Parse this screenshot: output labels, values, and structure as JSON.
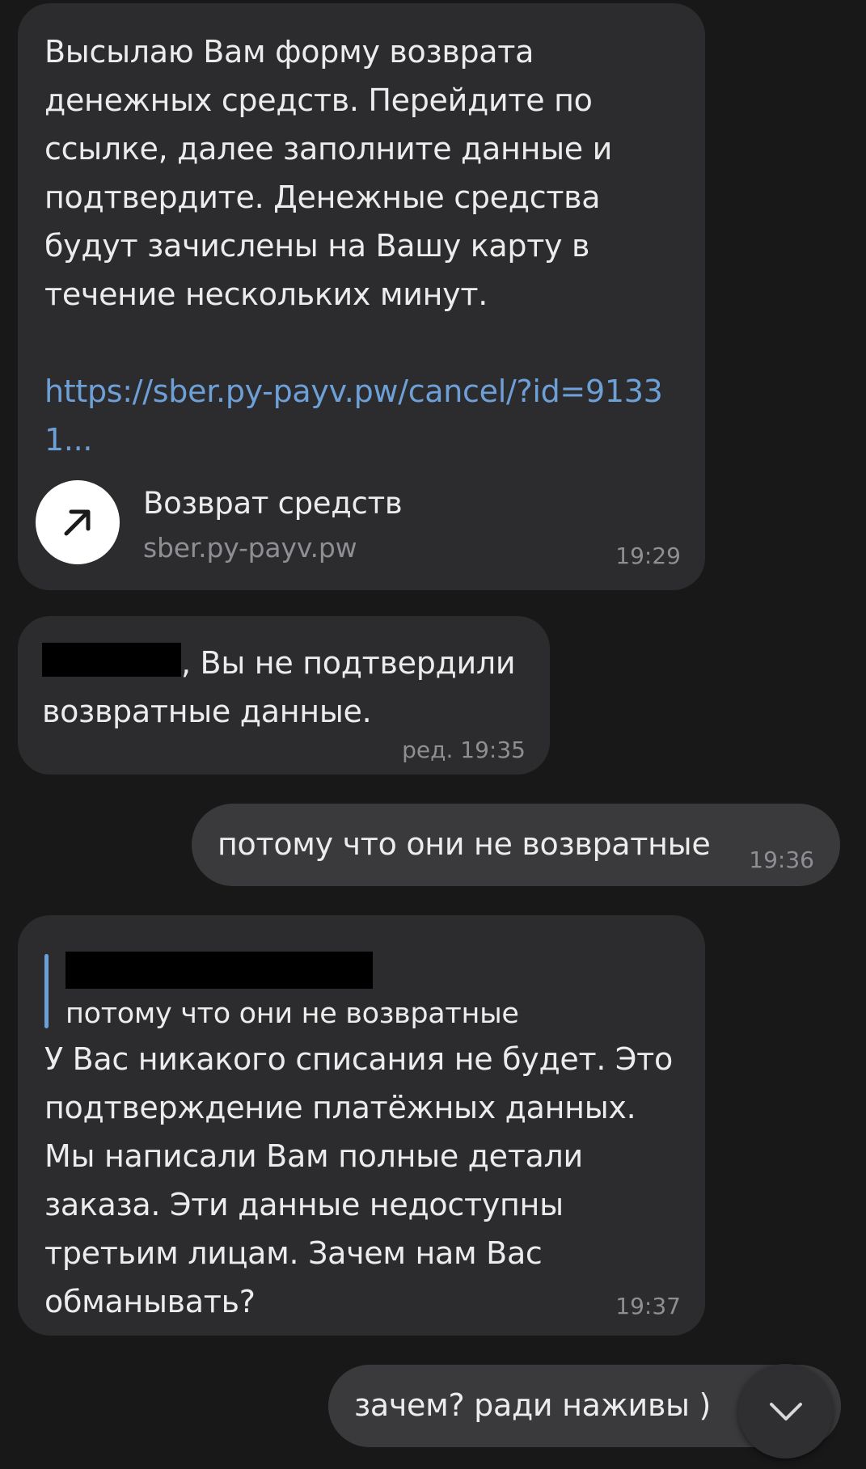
{
  "messages": {
    "m1": {
      "text": "Высылаю Вам форму возврата денежных средств. Перейдите по ссылке, далее заполните данные и подтвердите. Денежные средства будут зачислены на Вашу карту в течение нескольких минут.",
      "link": "https://sber.py-payv.pw/cancel/?id=91331...",
      "preview": {
        "icon": "arrow-up-right-icon",
        "title": "Возврат средств",
        "domain": "sber.py-payv.pw"
      },
      "time": "19:29"
    },
    "m2": {
      "text": ", Вы не подтвердили возвратные данные.",
      "time": "ред. 19:35"
    },
    "m3": {
      "text": "потому что они не возвратные",
      "time": "19:36"
    },
    "m4": {
      "reply_text": "потому что они не возвратные",
      "text": "У Вас никакого списания не будет. Это подтверждение платёжных данных. Мы написали Вам полные детали заказа. Эти данные недоступны третьим лицам. Зачем нам Вас обманывать?",
      "time": "19:37"
    },
    "m5": {
      "text": "зачем? ради наживы )"
    }
  },
  "scroll_button": {
    "icon": "chevron-down-icon"
  },
  "colors": {
    "background": "#181818",
    "incoming_bubble": "#2c2c2e",
    "outgoing_bubble": "#3a3a3c",
    "link": "#6ea0d8",
    "timestamp": "#8e8e93"
  }
}
